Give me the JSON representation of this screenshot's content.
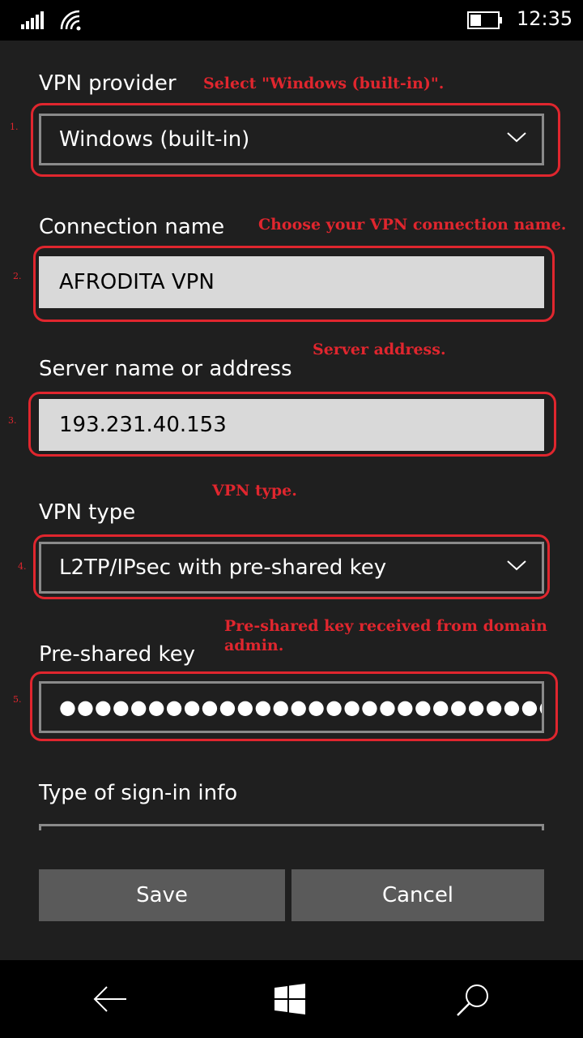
{
  "status_bar": {
    "time": "12:35"
  },
  "form": {
    "vpn_provider": {
      "label": "VPN provider",
      "value": "Windows (built-in)"
    },
    "connection_name": {
      "label": "Connection name",
      "value": "AFRODITA VPN"
    },
    "server": {
      "label": "Server name or address",
      "value": "193.231.40.153"
    },
    "vpn_type": {
      "label": "VPN type",
      "value": "L2TP/IPsec with pre-shared key"
    },
    "pre_shared_key": {
      "label": "Pre-shared key",
      "value": "●●●●●●●●●●●●●●●●●●●●●●●●●●●●●"
    },
    "sign_in_type": {
      "label": "Type of sign-in info"
    }
  },
  "buttons": {
    "save": "Save",
    "cancel": "Cancel"
  },
  "annotations": {
    "provider": "Select \"Windows (built-in)\".",
    "connection_name": "Choose your VPN connection name.",
    "server": "Server address.",
    "vpn_type": "VPN type.",
    "psk": "Pre-shared key received from domain admin.",
    "steps": [
      "1.",
      "2.",
      "3.",
      "4.",
      "5."
    ]
  },
  "colors": {
    "annotation_red": "#e0262e",
    "background": "#1f1f1f",
    "button": "#5a5a5a",
    "input_light": "#d9d9d9"
  },
  "icons": {
    "status": [
      "signal-icon",
      "wifi-icon",
      "battery-icon"
    ],
    "nav": [
      "back-arrow-icon",
      "windows-start-icon",
      "search-icon"
    ]
  }
}
